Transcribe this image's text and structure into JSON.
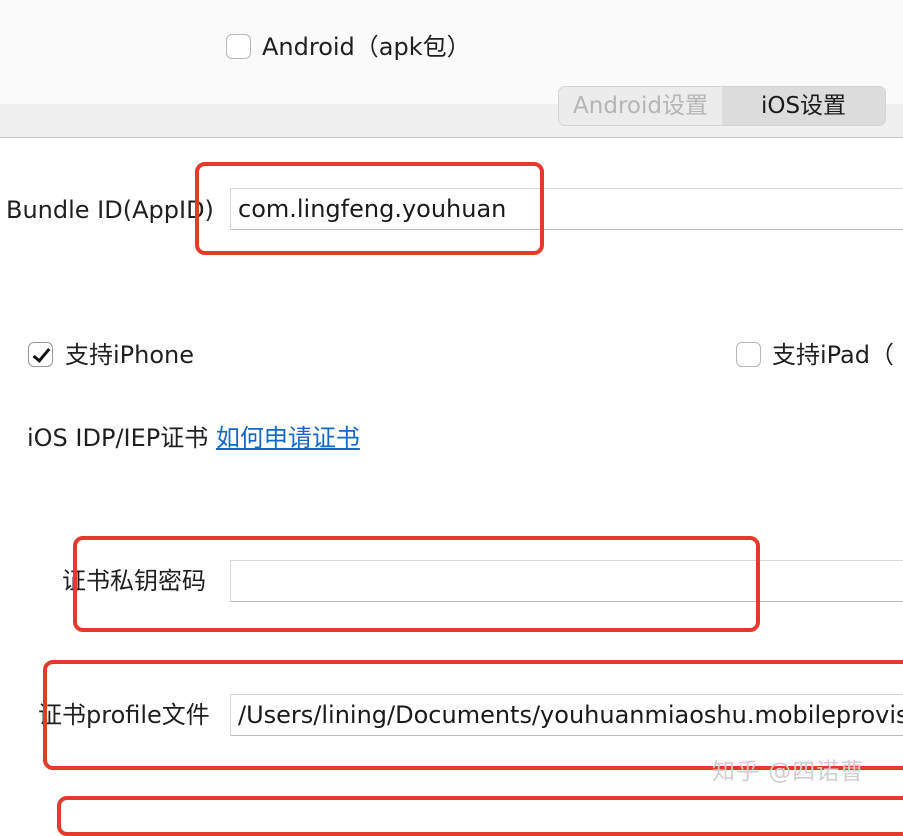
{
  "build": {
    "android_option": {
      "label": "Android（apk包）",
      "checked": false
    }
  },
  "tabs": [
    {
      "label": "Android设置",
      "active": false
    },
    {
      "label": "iOS设置",
      "active": true
    }
  ],
  "bundle": {
    "label": "Bundle ID(AppID)",
    "value": "com.lingfeng.youhuan"
  },
  "devices": {
    "iphone": {
      "label": "支持iPhone",
      "checked": true
    },
    "ipad": {
      "label": "支持iPad（",
      "checked": false
    }
  },
  "certificate": {
    "label": "iOS IDP/IEP证书",
    "help_link": "如何申请证书",
    "private_key_label": "证书私钥密码",
    "private_key_value": "",
    "profile_label": "证书profile文件",
    "profile_value": "/Users/lining/Documents/youhuanmiaoshu.mobileprovision"
  },
  "watermark": "知乎 @四诺曹",
  "colors": {
    "highlight": "#e33a2b",
    "link": "#1568c4"
  }
}
